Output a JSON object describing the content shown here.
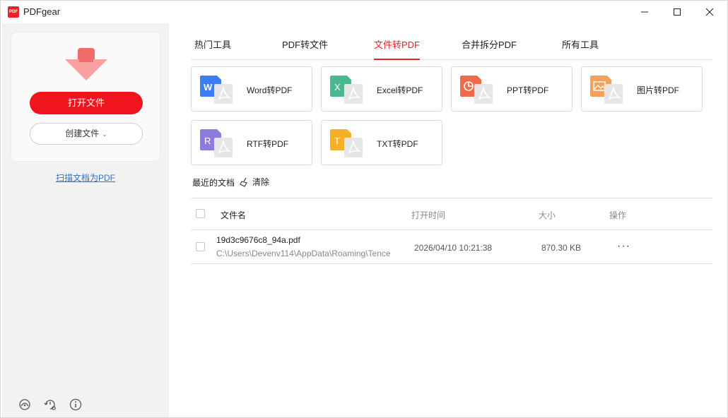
{
  "app": {
    "title": "PDFgear",
    "logo_text": "PDF"
  },
  "window_controls": {
    "minimize": "minimize-icon",
    "maximize": "maximize-icon",
    "close": "close-icon"
  },
  "sidebar": {
    "open_file_label": "打开文件",
    "create_file_label": "创建文件",
    "create_caret": "⌄",
    "scan_link": "扫描文档为PDF",
    "bottom_icons": [
      "support-icon",
      "history-settings-icon",
      "info-icon"
    ]
  },
  "tabs": [
    {
      "label": "热门工具",
      "active": false
    },
    {
      "label": "PDF转文件",
      "active": false
    },
    {
      "label": "文件转PDF",
      "active": true
    },
    {
      "label": "合并拆分PDF",
      "active": false
    },
    {
      "label": "所有工具",
      "active": false
    }
  ],
  "tools": [
    {
      "label": "Word转PDF",
      "icon": "word-to-pdf-icon",
      "color": "#3b7df2",
      "glyph": "W"
    },
    {
      "label": "Excel转PDF",
      "icon": "excel-to-pdf-icon",
      "color": "#4cb890",
      "glyph": "X"
    },
    {
      "label": "PPT转PDF",
      "icon": "ppt-to-pdf-icon",
      "color": "#f06a4a",
      "glyph": "◔"
    },
    {
      "label": "图片转PDF",
      "icon": "image-to-pdf-icon",
      "color": "#f2a25a",
      "glyph": "▭"
    },
    {
      "label": "RTF转PDF",
      "icon": "rtf-to-pdf-icon",
      "color": "#8f7be0",
      "glyph": "R"
    },
    {
      "label": "TXT转PDF",
      "icon": "txt-to-pdf-icon",
      "color": "#f5b02a",
      "glyph": "T"
    }
  ],
  "recent": {
    "title": "最近的文档",
    "clear_label": "清除",
    "columns": {
      "name": "文件名",
      "opened": "打开时间",
      "size": "大小",
      "actions": "操作"
    },
    "rows": [
      {
        "name": "19d3c9676c8_94a.pdf",
        "path": "C:\\Users\\Devenv114\\AppData\\Roaming\\Tence",
        "opened": "2026/04/10 10:21:38",
        "size": "870.30 KB",
        "actions": "···"
      }
    ]
  },
  "colors": {
    "accent": "#e8202a",
    "primary_button": "#f0141e",
    "link": "#2a72c8",
    "sidebar_bg": "#f2f2f2"
  }
}
